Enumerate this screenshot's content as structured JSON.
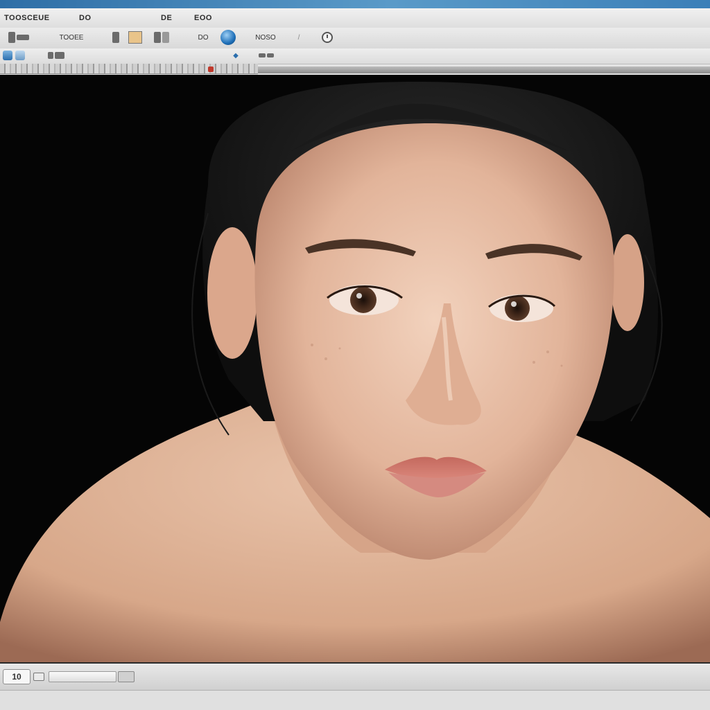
{
  "window": {
    "title": "",
    "accent": "#2e6ea6"
  },
  "menubar": {
    "items": [
      "TOOSCEUE",
      "DO",
      "DE",
      "EOO"
    ]
  },
  "toolbar": {
    "label_a": "TOOEE",
    "label_b": "DO",
    "label_c": "NOSO"
  },
  "icons": {
    "globe": "globe-icon",
    "clock": "clock-icon",
    "tab": "tab-icon"
  },
  "canvas": {
    "background": "#050505",
    "content": "portrait-photo"
  },
  "statusbar": {
    "zoom": "10"
  }
}
